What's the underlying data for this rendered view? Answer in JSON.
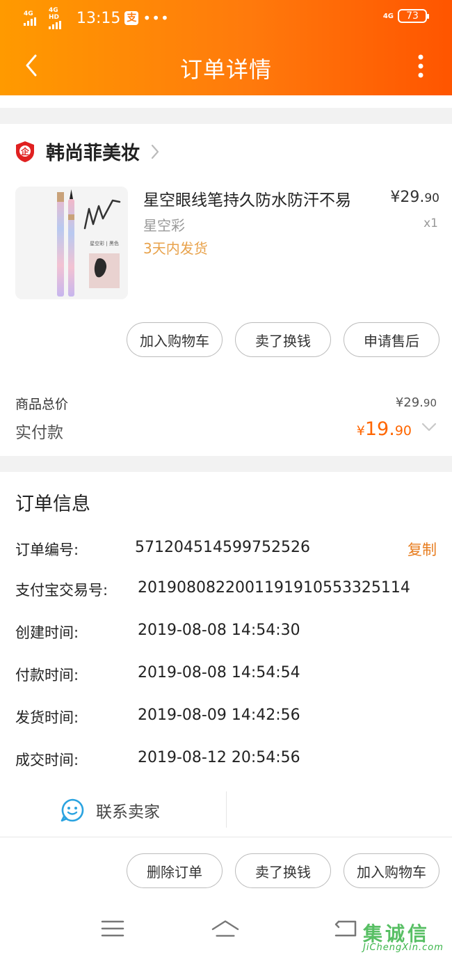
{
  "status_bar": {
    "sim1_label": "4G",
    "sim2_label": "4G HD",
    "time": "13:15",
    "pay_icon_glyph": "支",
    "more_glyph": "•••",
    "right_net": "4G",
    "battery": "73"
  },
  "header": {
    "title": "订单详情",
    "back_icon": "chevron-left-icon",
    "more_icon": "vertical-dots-icon",
    "gradient_from": "#ff9a00",
    "gradient_to": "#ff5500"
  },
  "shop": {
    "badge_glyph": "企",
    "name": "韩尚菲美妆"
  },
  "product": {
    "title": "星空眼线笔持久防水防汗不易",
    "spec": "星空彩",
    "shipping": "3天内发货",
    "price_main": "¥29.",
    "price_cents": "90",
    "quantity": "x1",
    "image_caption": "星空彩 | 黑色"
  },
  "item_actions": {
    "add_cart": "加入购物车",
    "resell": "卖了换钱",
    "after_sale": "申请售后"
  },
  "summary": {
    "total_label": "商品总价",
    "total_main": "¥29.",
    "total_cents": "90",
    "paid_label": "实付款",
    "paid_currency": "¥",
    "paid_main": "19.",
    "paid_cents": "90"
  },
  "order_info": {
    "title": "订单信息",
    "copy_label": "复制",
    "rows": [
      {
        "label": "订单编号:",
        "value": "571204514599752526"
      },
      {
        "label": "支付宝交易号:",
        "value": "2019080822001191910553325114"
      },
      {
        "label": "创建时间:",
        "value": "2019-08-08 14:54:30"
      },
      {
        "label": "付款时间:",
        "value": "2019-08-08 14:54:54"
      },
      {
        "label": "发货时间:",
        "value": "2019-08-09 14:42:56"
      },
      {
        "label": "成交时间:",
        "value": "2019-08-12 20:54:56"
      }
    ]
  },
  "contact": {
    "label": "联系卖家"
  },
  "bottom_actions": {
    "delete": "删除订单",
    "resell": "卖了换钱",
    "add_cart": "加入购物车"
  },
  "watermark": {
    "glyphs": "集诚信",
    "url": "JiChengXin.com"
  },
  "colors": {
    "accent": "#ff6600",
    "ship_text": "#e8a24b",
    "copy_text": "#e77c1e",
    "contact_icon": "#2aa3e0",
    "shop_badge": "#e02020"
  }
}
